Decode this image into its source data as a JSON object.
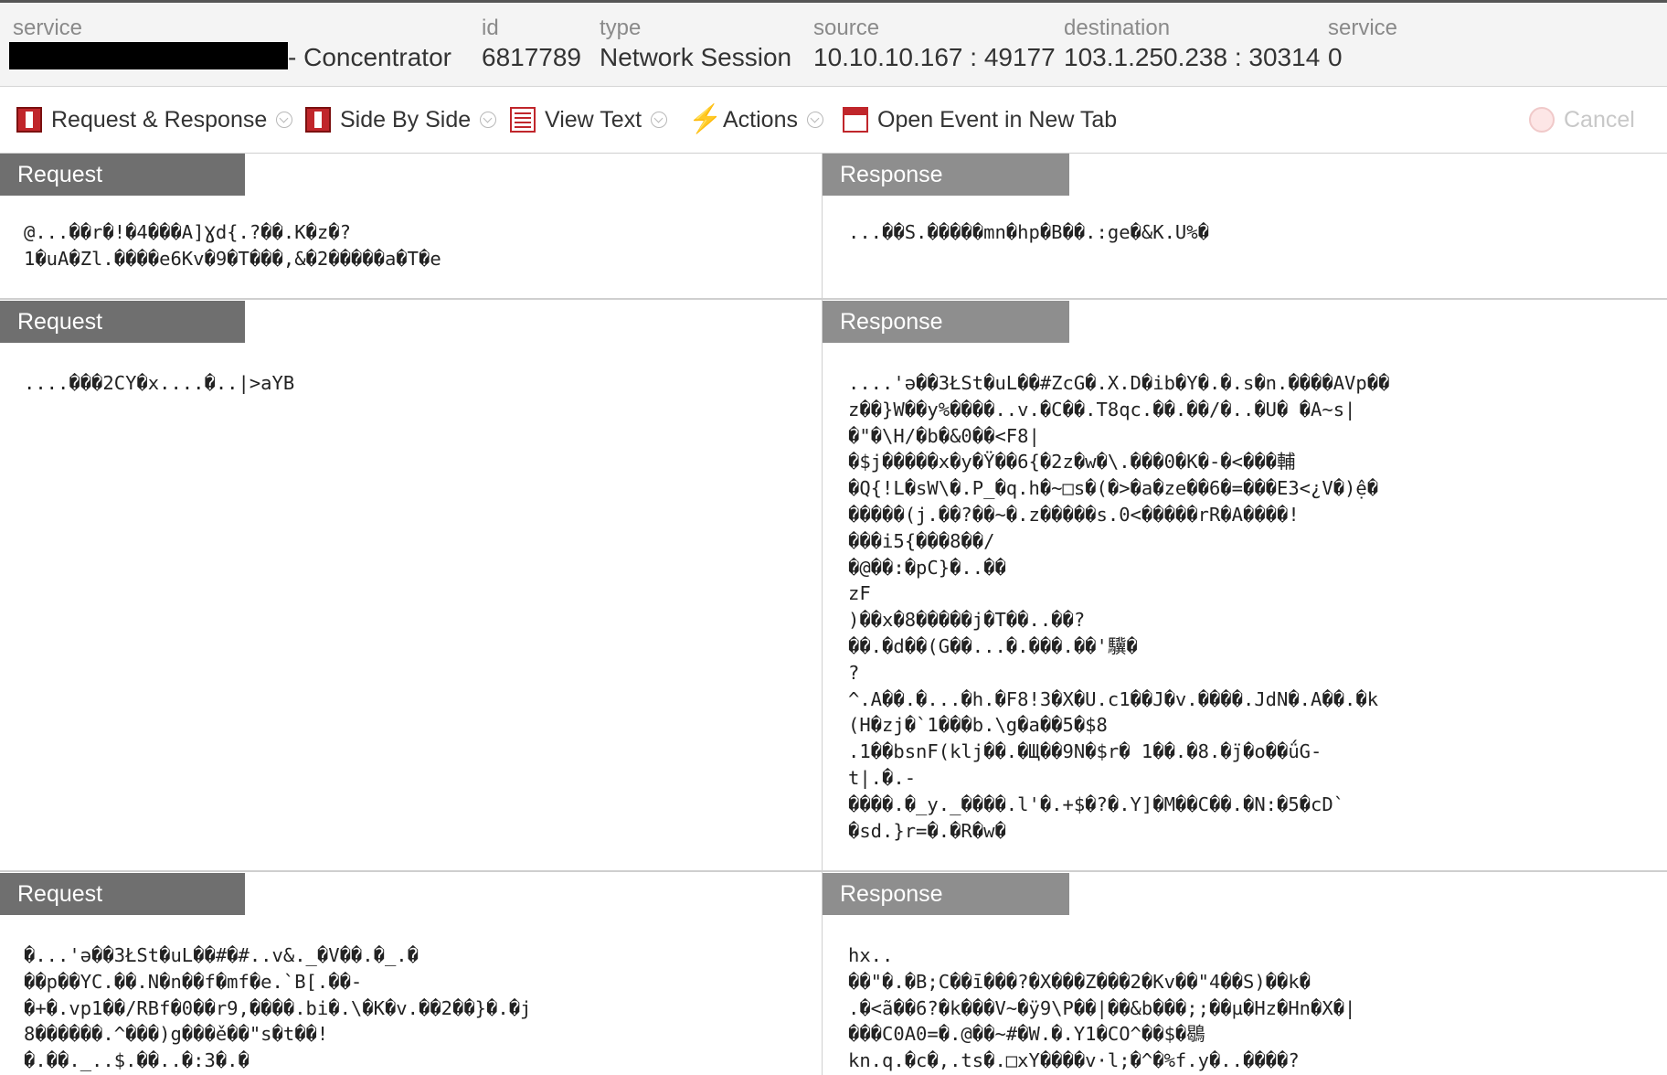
{
  "header": {
    "service": {
      "label": "service",
      "value": "- Concentrator"
    },
    "id": {
      "label": "id",
      "value": "6817789"
    },
    "type": {
      "label": "type",
      "value": "Network Session"
    },
    "source": {
      "label": "source",
      "value": "10.10.10.167 : 49177"
    },
    "destination": {
      "label": "destination",
      "value": "103.1.250.238 : 30314"
    },
    "service2": {
      "label": "service",
      "value": "0"
    }
  },
  "toolbar": {
    "request_response": "Request & Response",
    "side_by_side": "Side By Side",
    "view_text": "View Text",
    "actions": "Actions",
    "open_event": "Open Event in New Tab",
    "cancel": "Cancel"
  },
  "panes": [
    {
      "request_title": "Request",
      "request_body": "@...��r�!�4���A]Ɣd{.?��.K�z�?\n1�uA�Zl.����e6Kv�9�T���,&�2�����a�T�e",
      "response_title": "Response",
      "response_body": "...��S.�����mn�hp�B��.:ge�&K.U%�"
    },
    {
      "request_title": "Request",
      "request_body": "....���2CY�x....�..|>aYB",
      "response_title": "Response",
      "response_body": "....'ə��3ŁSt�uL��#ZcG�.X.D�ib�Y�.�.s�n.����AVp��\nz��}W��y%����..v.�C��.T8qc.��.��/�..�U� �A~s|\n�\"�\\H/�b�&0��<F8|\n�$j�����x�y�Ÿ��6{�2z�w�\\.���0�K�-�<���輔\n�Q{!L�sW\\�.P_�q.h�~□s�(�>�a�ze��6�=���E3<¿V�)ệ�\n�����(j.��?��~�.z�����s.0<�����rR�A����!\n���i5{���8��/\n�@��:�pC}�..��\nzF\n)��x�8�����j�T��..��?\n��.�d��(G��...�.���.��'驥�\n?\n^.A��.�...�h.�F8!3�X�U.c1��J�v.����.JdN�.A��.�k\n(H�zj�`1���b.\\g�a��5�$8\n.1��bsnF(klj��.�Щ��9N�$r� 1��.�8.�j̈�o��ǘG-\nt|.�.-\n����.�_y._����.l'�.+$�?�.Y]�M��C��.�N:�5�cD`\n�sd.}r=�.�R�w�"
    },
    {
      "request_title": "Request",
      "request_body": "�...'ə��3ŁSt�uL��#�#..v&._�V��.�_.�\n��p��YC.��.N�n��f�mf�e.`B[.��-\n�+�.vp1��/RBf�0��r9,����.bi�.\\�K�v.��2��}�.�ϳ\n8������.^���)g���ě��\"s�t��!\n�.��._..$.��..�:3�.�",
      "response_title": "Response",
      "response_body": "hx..\n��\"�.�B;C��ī���?�X���Z���2�Kv��\"4��S)��k�\n.�<ã��6?�k���V~�ÿ9\\P��|��&b���;;��µ�Hz�Hn�X�|\n���C0A0=�.@��~#�W.�.Y1�CO^��$�鶡\nkn.q.�c�,.ts�.□xY����v·l;�^�%f.y�..����?"
    }
  ]
}
